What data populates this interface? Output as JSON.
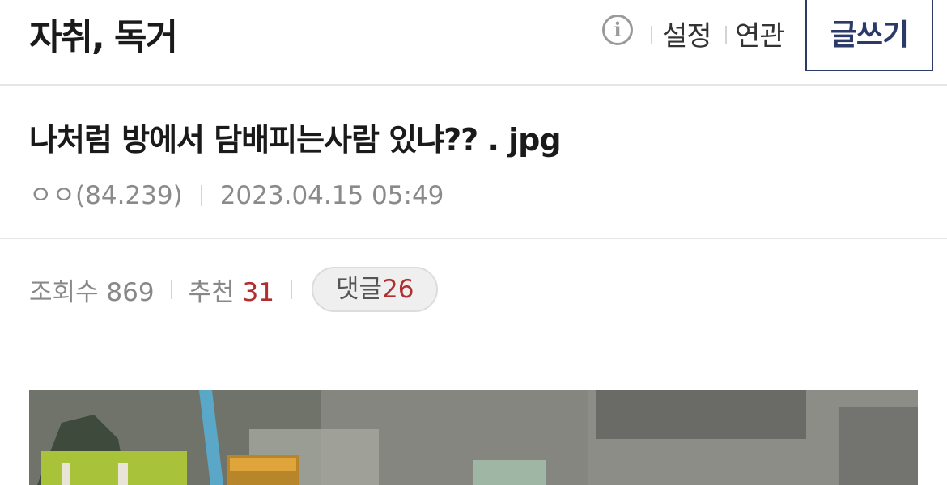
{
  "header": {
    "gallery_name": "자취, 독거",
    "settings_label": "설정",
    "related_label": "연관",
    "write_label": "글쓰기"
  },
  "post": {
    "title": "나처럼 방에서 담배피는사람 있냐?? . jpg",
    "author": "ㅇㅇ(84.239)",
    "datetime": "2023.04.15 05:49"
  },
  "stats": {
    "views_label": "조회수",
    "views_value": "869",
    "recommend_label": "추천",
    "recommend_value": "31",
    "comments_label": "댓글",
    "comments_value": "26"
  },
  "colors": {
    "accent": "#2c3a6a",
    "count_red": "#b03030"
  },
  "icons": {
    "info": "info-circle-icon"
  }
}
